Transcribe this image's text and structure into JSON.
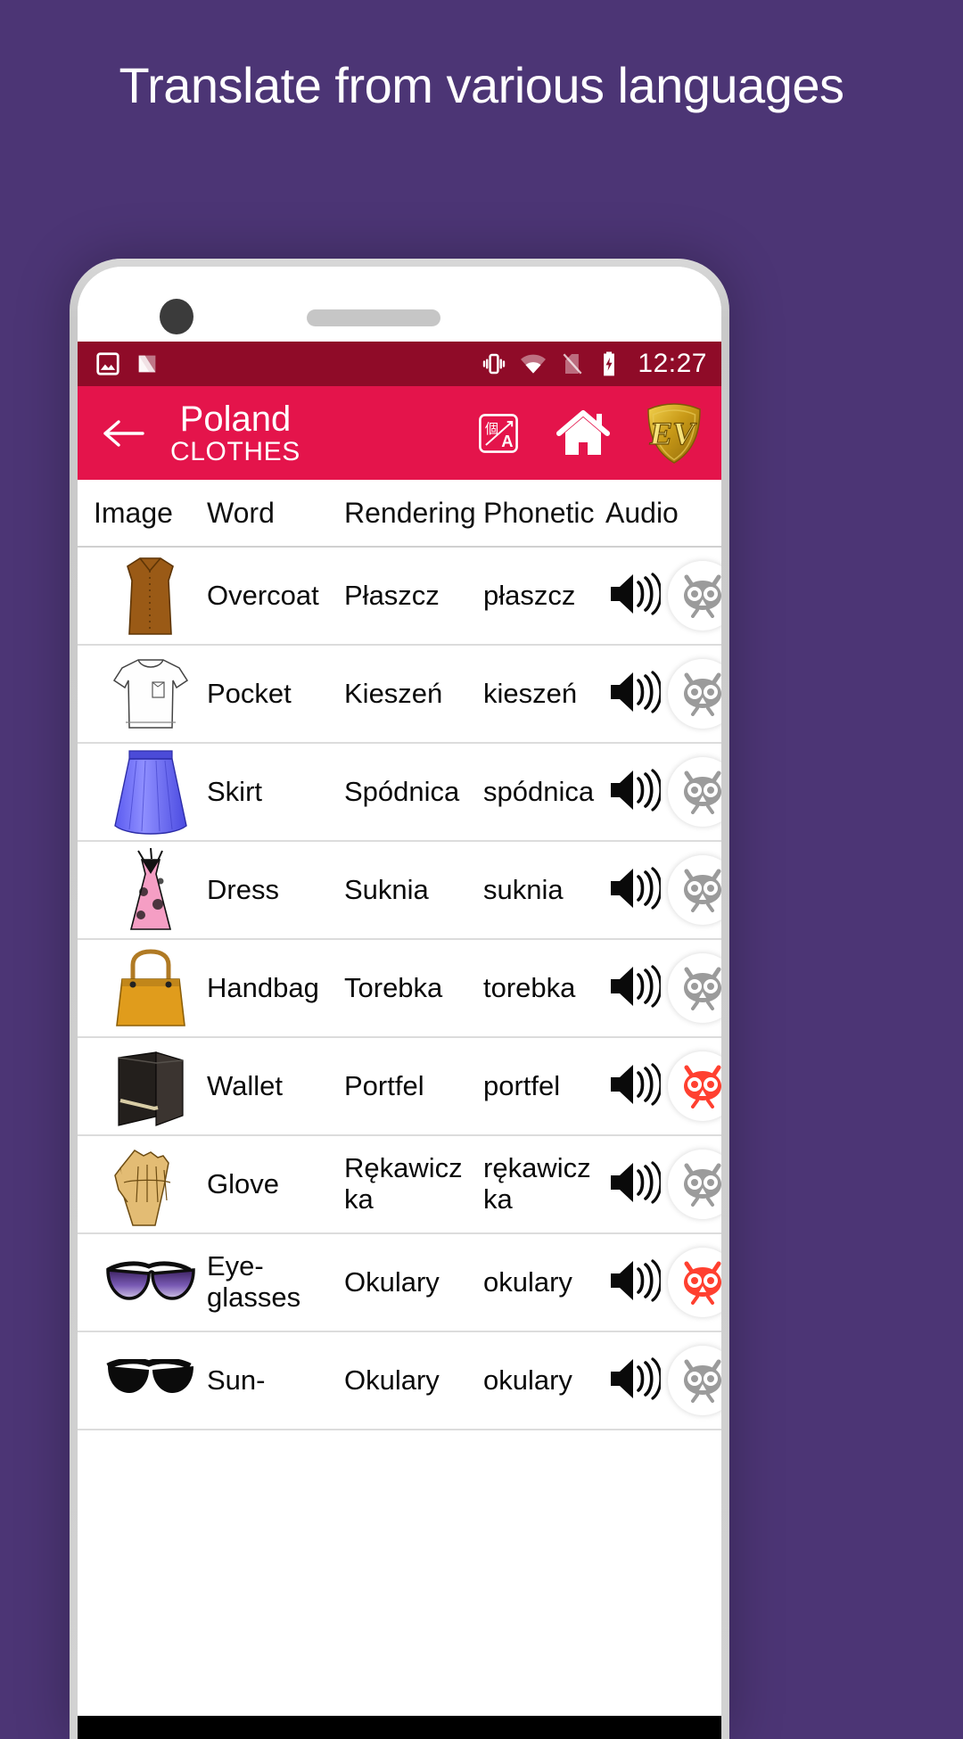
{
  "promo": {
    "headline": "Translate from various languages",
    "background_color": "#4c3575"
  },
  "phone": {
    "status_bar": {
      "background_color": "#8f0b28",
      "time": "12:27",
      "left_icons": [
        "screenshot-icon",
        "nova-launcher-icon"
      ],
      "right_icons": [
        "vibrate-icon",
        "wifi-icon",
        "no-sim-icon",
        "battery-charging-icon"
      ]
    },
    "app_header": {
      "background_color": "#e4144b",
      "back_label": "back-arrow",
      "title": "Poland",
      "subtitle": "CLOTHES",
      "actions": [
        {
          "name": "translate-icon",
          "label": "Translate"
        },
        {
          "name": "home-icon",
          "label": "Home"
        },
        {
          "name": "ev-logo-icon",
          "label": "EV"
        }
      ]
    },
    "table": {
      "columns": [
        "Image",
        "Word",
        "Rendering",
        "Phonetic",
        "Audio"
      ],
      "rows": [
        {
          "image": "overcoat",
          "word": "Overcoat",
          "rendering": "Płaszcz",
          "phonetic": "płaszcz",
          "audio": "speaker-icon",
          "favorite": false
        },
        {
          "image": "pocket",
          "word": "Pocket",
          "rendering": "Kieszeń",
          "phonetic": "kieszeń",
          "audio": "speaker-icon",
          "favorite": false
        },
        {
          "image": "skirt",
          "word": "Skirt",
          "rendering": "Spódnica",
          "phonetic": "spódnica",
          "audio": "speaker-icon",
          "favorite": false
        },
        {
          "image": "dress",
          "word": "Dress",
          "rendering": "Suknia",
          "phonetic": "suknia",
          "audio": "speaker-icon",
          "favorite": false
        },
        {
          "image": "handbag",
          "word": "Handbag",
          "rendering": "Torebka",
          "phonetic": "torebka",
          "audio": "speaker-icon",
          "favorite": false
        },
        {
          "image": "wallet",
          "word": "Wallet",
          "rendering": "Portfel",
          "phonetic": "portfel",
          "audio": "speaker-icon",
          "favorite": true
        },
        {
          "image": "glove",
          "word": "Glove",
          "rendering": "Rękawiczka",
          "phonetic": "rękawiczka",
          "audio": "speaker-icon",
          "favorite": false
        },
        {
          "image": "glasses",
          "word": "Eye-glasses",
          "rendering": "Okulary",
          "phonetic": "okulary",
          "audio": "speaker-icon",
          "favorite": true
        },
        {
          "image": "sunglasses",
          "word": "Sun-",
          "rendering": "Okulary",
          "phonetic": "okulary",
          "audio": "speaker-icon",
          "favorite": false
        }
      ],
      "favorite_color_active": "#ff4030",
      "favorite_color_inactive": "#9b9b9b"
    }
  }
}
